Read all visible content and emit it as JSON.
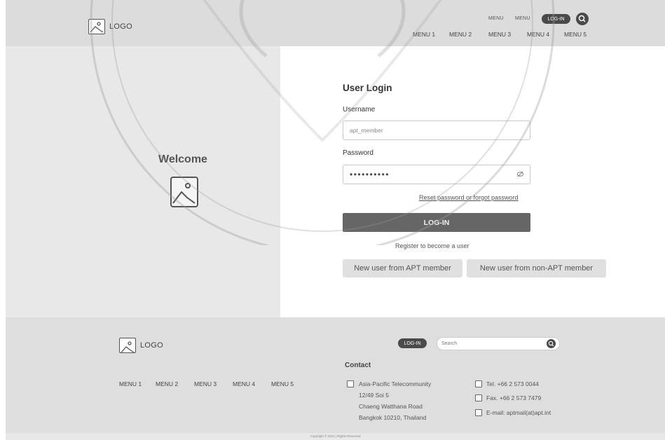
{
  "header": {
    "logo_label": "LOGO",
    "top_links": [
      "MENU",
      "MENU"
    ],
    "login_label": "LOG-IN",
    "nav": [
      "MENU 1",
      "MENU 2",
      "MENU 3",
      "MENU 4",
      "MENU 5"
    ]
  },
  "welcome": {
    "title": "Welcome"
  },
  "login_form": {
    "title": "User Login",
    "username_label": "Username",
    "username_value": "apt_member",
    "password_label": "Password",
    "password_value": "••••••••••",
    "reset_link": "Reset password or forgot password",
    "login_button": "LOG-IN",
    "register_text": "Register to become a user",
    "new_apt_button": "New user from APT member",
    "new_non_apt_button": "New user from non-APT member"
  },
  "footer": {
    "logo_label": "LOGO",
    "menu": [
      "MENU 1",
      "MENU 2",
      "MENU 3",
      "MENU 4",
      "MENU 5"
    ],
    "login_label": "LOG-IN",
    "search_placeholder": "Search",
    "contact_title": "Contact",
    "address": [
      "Asia-Pacific Telecommunity",
      "12/49 Soi 5",
      "Chaeng Watthana Road",
      "Bangkok 10210, Thailand"
    ],
    "tel": "Tel. +66 2 573 0044",
    "fax": "Fax. +66 2 573 7479",
    "email": "E-mail: aptmail(at)apt.int",
    "copyright": "Copyright © 2021 | Rights Reserved"
  },
  "colors": {
    "header_bg": "#dcdcdc",
    "panel_bg": "#e8e8e8",
    "button_bg": "#666666",
    "pill_bg": "#4a4a4a"
  }
}
